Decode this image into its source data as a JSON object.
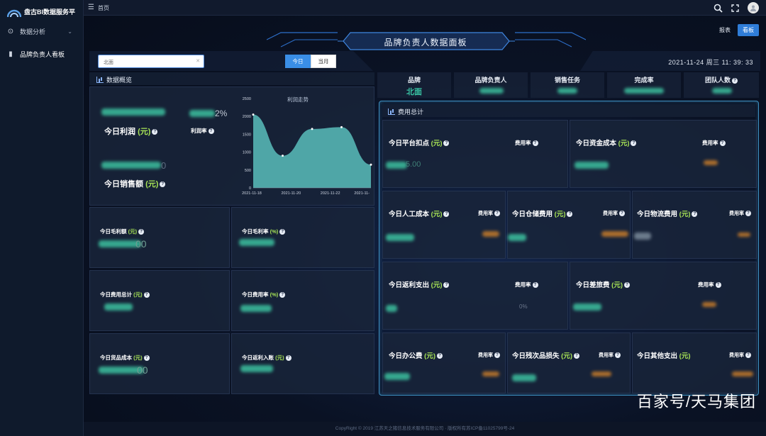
{
  "app": {
    "title": "盘古BI数据服务平"
  },
  "sidebar": {
    "items": [
      {
        "label": "数据分析",
        "icon": "target-icon"
      },
      {
        "label": "品牌负责人看板",
        "icon": "bar-chart-icon"
      }
    ]
  },
  "topbar": {
    "breadcrumb": "首页"
  },
  "header": {
    "title": "品牌负责人数据面板",
    "report_label": "报表",
    "board_label": "看板"
  },
  "filters": {
    "region_value": "北面",
    "period_options": [
      "今日",
      "当月"
    ],
    "period_selected": "今日"
  },
  "datetime": "2021-11-24 周三 11: 39: 33",
  "overview": {
    "title": "数据概览",
    "profit_label": "今日利润",
    "profit_unit": "(元)",
    "profit_rate_label": "利润率",
    "profit_rate_value": "2%",
    "sales_label": "今日销售额",
    "sales_unit": "(元)",
    "sales_value_tail": "0",
    "gross_profit_label": "今日毛利额",
    "gross_profit_unit": "(元)",
    "gross_profit_tail": "00",
    "gross_rate_label": "今日毛利率",
    "gross_rate_unit": "(%)",
    "expense_total_label": "今日费用总计",
    "expense_total_unit": "(元)",
    "expense_rate_label": "今日费用率",
    "expense_rate_unit": "(%)",
    "goods_cost_label": "今日货品成本",
    "goods_cost_unit": "(元)",
    "goods_cost_tail": "00",
    "rebate_in_label": "今日返利入账",
    "rebate_in_unit": "(元)"
  },
  "chart_data": {
    "type": "area",
    "title": "利润走势",
    "x": [
      "2021-11-18",
      "2021-11-20",
      "2021-11-22",
      "2021-11-"
    ],
    "y_ticks": [
      "2500",
      "2000",
      "1500",
      "1000",
      "500",
      "0"
    ],
    "values": [
      2050,
      900,
      1650,
      1700,
      650
    ],
    "color": "#4fa6a7"
  },
  "brand_info": {
    "brand_label": "品牌",
    "brand_value": "北面",
    "owner_label": "品牌负责人",
    "task_label": "销售任务",
    "completion_label": "完成率",
    "team_label": "团队人数"
  },
  "fees": {
    "title": "费用总计",
    "rate_label": "费用率",
    "items": [
      {
        "label": "今日平台扣点",
        "unit": "(元)",
        "value_tail": "5.00"
      },
      {
        "label": "今日资金成本",
        "unit": "(元)"
      },
      {
        "label": "今日人工成本",
        "unit": "(元)"
      },
      {
        "label": "今日仓储费用",
        "unit": "(元)"
      },
      {
        "label": "今日物流费用",
        "unit": "(元)"
      },
      {
        "label": "今日返利支出",
        "unit": "(元)",
        "rate_tail": "0%"
      },
      {
        "label": "今日差旅费",
        "unit": "(元)"
      },
      {
        "label": "今日办公费",
        "unit": "(元)"
      },
      {
        "label": "今日残次品损失",
        "unit": "(元)"
      },
      {
        "label": "今日其他支出",
        "unit": "(元)"
      }
    ]
  },
  "footer": "CopyRight © 2019 江苏天之猪信息技术服务有限公司 · 版权所有苏ICP备11025799号-24",
  "watermark": "百家号/天马集团",
  "colors": {
    "accent": "#39c4a4",
    "unit": "#a7e356",
    "primary_button": "#2f7dd8"
  }
}
